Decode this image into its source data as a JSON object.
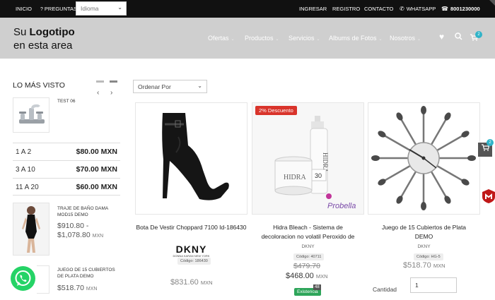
{
  "topbar": {
    "inicio": "INICIO",
    "preguntas_icon": "question-icon",
    "preguntas": "PREGUNTAS",
    "idioma": "Idioma",
    "ingresar": "INGRESAR",
    "registro": "REGISTRO",
    "contacto": "CONTACTO",
    "whatsapp_icon": "whatsapp-icon",
    "whatsapp": "WHATSAPP",
    "phone_icon": "phone-icon",
    "phone": "8001230000"
  },
  "header": {
    "logo_line1_a": "Su ",
    "logo_line1_b": "Logotipo",
    "logo_line2": "en esta area",
    "nav": [
      "Ofertas",
      "Productos",
      "Servicios",
      "Albums de Fotos",
      "Nosotros"
    ],
    "cart_count": "2"
  },
  "sidebar": {
    "title": "LO MÁS VISTO",
    "item1": {
      "name": "TEST 06"
    },
    "tiers": [
      {
        "qty": "1 A 2",
        "price": "$80.00 MXN"
      },
      {
        "qty": "3 A 10",
        "price": "$70.00 MXN"
      },
      {
        "qty": "11 A 20",
        "price": "$60.00 MXN"
      }
    ],
    "item2": {
      "name": "TRAJE DE BAÑO DAMA MOD15 DEMO",
      "price_from": "$910.80",
      "price_to": "$1,078.80",
      "currency": "MXN"
    },
    "item3": {
      "name": "JUEGO DE 15 CUBIERTOS DE PLATA DEMO",
      "price": "$518.70",
      "currency": "MXN"
    }
  },
  "sort": {
    "label": "Ordenar Por"
  },
  "products": [
    {
      "title": "Bota De Vestir Choppard 7100 Id-186430",
      "brand_logo": "DKNY",
      "brand_sub": "DONNA KARAN NEW YORK",
      "code": "Código: 186430",
      "price": "$831.60",
      "currency": "MXN"
    },
    {
      "badge": "2% Descuento",
      "title_line1": "Hidra Bleach - Sistema de",
      "title_line2": "decoloracion no volatil Peroxido de",
      "brand": "DKNY",
      "code": "Código: 40711",
      "old_price": "$479.70",
      "price": "$468.00",
      "currency": "MXN",
      "stock_label": "Existencia",
      "stock_count": "48",
      "hidra_text": "HIDRA",
      "probella": "Probella",
      "jar_number": "30"
    },
    {
      "title_line1": "Juego de 15 Cubiertos de Plata",
      "title_line2": "DEMO",
      "brand": "DKNY",
      "code": "Código: HG-5",
      "price": "$518.70",
      "currency": "MXN",
      "qty_label": "Cantidad",
      "qty_value": "1"
    }
  ],
  "floats": {
    "cart_count": "2"
  }
}
